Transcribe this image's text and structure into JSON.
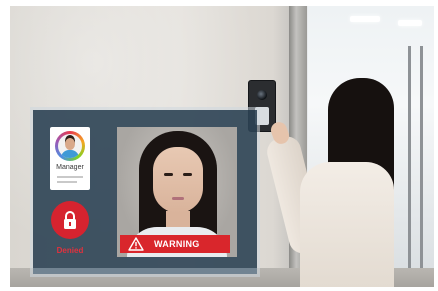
{
  "overlay": {
    "id_card": {
      "role": "Manager"
    },
    "lock": {
      "label": "Denied",
      "icon": "lock-icon"
    },
    "alert": {
      "label": "WARNING",
      "icon": "warning-triangle-icon"
    }
  },
  "colors": {
    "panel": "#2c4254",
    "alert_red": "#d9262c",
    "lock_red": "#d6232f"
  }
}
